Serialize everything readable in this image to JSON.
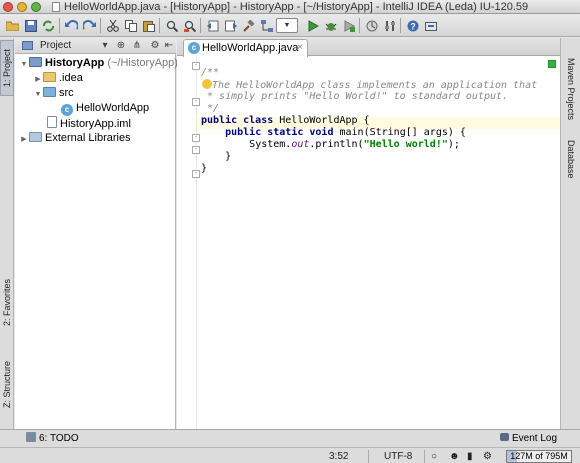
{
  "window": {
    "title": "HelloWorldApp.java - [HistoryApp] - HistoryApp - [~/HistoryApp] - IntelliJ IDEA (Leda) IU-120.59"
  },
  "toolbar": {
    "buttons": [
      "open-icon",
      "save-icon",
      "sync-icon",
      "undo-icon",
      "redo-icon",
      "cut-icon",
      "copy-icon",
      "paste-icon",
      "find-icon",
      "replace-icon",
      "back-icon",
      "forward-icon",
      "make-icon",
      "run-config-icon",
      "run-icon",
      "debug-icon",
      "coverage-icon",
      "stop-icon",
      "vcs-icon",
      "settings-icon",
      "structure-icon",
      "help-icon",
      "sdk-icon"
    ]
  },
  "left_stripe": {
    "tabs": [
      {
        "label": "1: Project"
      },
      {
        "label": "2: Favorites"
      },
      {
        "label": "Z: Structure"
      }
    ]
  },
  "right_stripe": {
    "tabs": [
      {
        "label": "Maven Projects"
      },
      {
        "label": "Database"
      }
    ]
  },
  "project_panel": {
    "view_label": "Project",
    "tree": [
      {
        "label": "HistoryApp",
        "suffix": "(~/HistoryApp)"
      },
      {
        "label": ".idea"
      },
      {
        "label": "src"
      },
      {
        "label": "HelloWorldApp"
      },
      {
        "label": "HistoryApp.iml"
      },
      {
        "label": "External Libraries"
      }
    ]
  },
  "editor": {
    "tab_label": "HelloWorldApp.java",
    "code": {
      "line1": "/**",
      "line2": "The HelloWorldApp class implements an application that",
      "line3": " * simply prints \"Hello World!\" to standard output.",
      "line4": " */",
      "line5_kw": "public class",
      "line5_rest": " HelloWorldApp {",
      "line6_kw": "public static void",
      "line6_rest": " main(String[] args) {",
      "line7_a": "System.",
      "line7_field": "out",
      "line7_b": ".println(",
      "line7_str": "\"Hello world!\"",
      "line7_c": ");",
      "line8": "}",
      "line9": "}"
    }
  },
  "statusbar": {
    "todo_label": "6: TODO",
    "event_log_label": "Event Log",
    "caret_position": "3:52",
    "encoding": "UTF-8",
    "memory_text": "127M of 795M",
    "memory_used_fraction": 0.16
  }
}
